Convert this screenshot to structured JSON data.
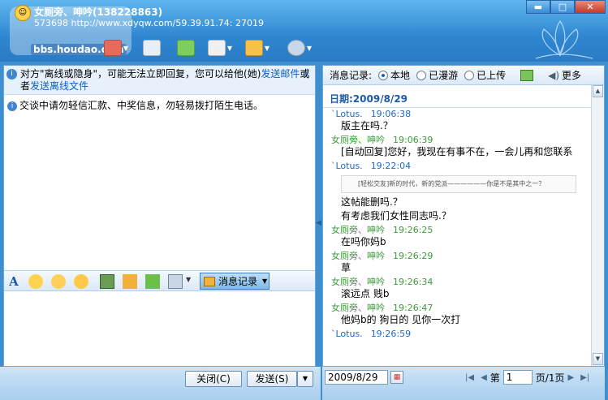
{
  "title": {
    "name": "女厕旁、呻吟(138228863)",
    "sub": "573698 http://www.xdyqw.com/59.39.91.74: 27019",
    "watermark": "bbs.houdao.com"
  },
  "window": {
    "minimize": "▬",
    "maximize": "□",
    "close": "✕"
  },
  "notice": {
    "text1": "对方\"离线或隐身\"，可能无法立即回复，您可以给他(她)",
    "link1": "发送邮件",
    "text2": "或者",
    "link2": "发送离线文件"
  },
  "warning": "交谈中请勿轻信汇款、中奖信息，勿轻易拨打陌生电话。",
  "format_bar": {
    "history_label": "消息记录"
  },
  "buttons": {
    "close": "关闭(C)",
    "send": "发送(S)",
    "send_arrow": "▼"
  },
  "history": {
    "label": "消息记录:",
    "opt_local": "本地",
    "opt_roam": "已漫游",
    "opt_upload": "已上传",
    "more": "更多",
    "date_header": "日期:2009/8/29",
    "messages": [
      {
        "sender": "`Lotus.",
        "time": "19:06:38",
        "text": "版主在吗.？"
      },
      {
        "sender": "女厕旁、呻吟",
        "time": "19:06:39",
        "text": "[自动回复]您好，我现在有事不在，一会儿再和您联系"
      },
      {
        "sender": "`Lotus.",
        "time": "19:22:04",
        "text": "",
        "quote": "[轻松交友]新的时代，新的党派——————你是不是其中之一？"
      },
      {
        "sender": "",
        "time": "",
        "text": "这帖能删吗.？"
      },
      {
        "sender": "",
        "time": "",
        "text": "有考虑我们女性同志吗.？"
      },
      {
        "sender": "女厕旁、呻吟",
        "time": "19:26:25",
        "text": "在吗你妈b"
      },
      {
        "sender": "女厕旁、呻吟",
        "time": "19:26:29",
        "text": "草"
      },
      {
        "sender": "女厕旁、呻吟",
        "time": "19:26:34",
        "text": "滚远点  贱b"
      },
      {
        "sender": "女厕旁、呻吟",
        "time": "19:26:47",
        "text": "他妈b的  狗日的  见你一次打"
      },
      {
        "sender": "`Lotus.",
        "time": "19:26:59",
        "text": ""
      }
    ],
    "date_input": "2009/8/29",
    "page_prefix": "第",
    "page_value": "1",
    "page_suffix": "页/1页"
  }
}
